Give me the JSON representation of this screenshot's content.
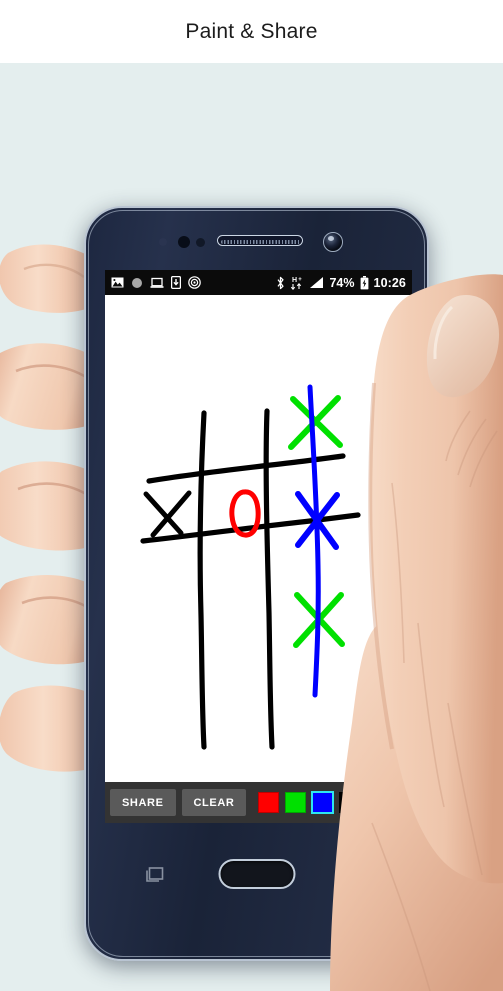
{
  "window": {
    "title": "Paint & Share",
    "background_color": "#e4eeee",
    "title_bar_color": "#ffffff"
  },
  "phone": {
    "device_style": "android-smartphone-in-hand",
    "hardware": {
      "speaker_name": "earpiece-speaker",
      "camera_name": "front-camera",
      "home_button_label": "Home",
      "recent_apps_label": "Recent apps",
      "back_label": "Back"
    }
  },
  "status_bar": {
    "background_color": "#0b0b0b",
    "text_color": "#ffffff",
    "left_icons": [
      {
        "name": "image-icon",
        "glyph": "⛰"
      },
      {
        "name": "circle-icon",
        "glyph": "●"
      },
      {
        "name": "laptop-icon",
        "glyph": "⌸"
      },
      {
        "name": "download-icon",
        "glyph": "⬇"
      },
      {
        "name": "cast-wireless-icon",
        "glyph": "὏6"
      }
    ],
    "right_icons": [
      {
        "name": "bluetooth-icon",
        "glyph": "ᛦ"
      },
      {
        "name": "hspa-plus-icon",
        "label": "H+"
      },
      {
        "name": "signal-icon",
        "glyph": "◢"
      }
    ],
    "battery_percent": "74%",
    "battery_icon_name": "battery-charging-icon",
    "clock": "10:26"
  },
  "app": {
    "canvas": {
      "name": "drawing-canvas",
      "background_color": "#ffffff",
      "content_description": "tic-tac-toe board sketch"
    },
    "toolbar": {
      "background_color": "#333333",
      "share_label": "SHARE",
      "clear_label": "CLEAR",
      "button_color": "#5a5a5a",
      "colors": [
        {
          "name": "swatch-red",
          "hex": "#ff0000",
          "selected": false
        },
        {
          "name": "swatch-green",
          "hex": "#00e000",
          "selected": false
        },
        {
          "name": "swatch-blue",
          "hex": "#0000ff",
          "selected": true
        },
        {
          "name": "swatch-black",
          "hex": "#000000",
          "selected": false
        },
        {
          "name": "swatch-white",
          "hex": "#ffffff",
          "selected": false
        }
      ],
      "selected_color_hex": "#0000ff",
      "selection_outline_hex": "#2ee6f0"
    }
  },
  "drawing": {
    "type": "freehand-sketch",
    "subject": "tic-tac-toe",
    "strokes": [
      {
        "id": "grid-vertical-left",
        "color": "#000000",
        "width": 5
      },
      {
        "id": "grid-vertical-right",
        "color": "#000000",
        "width": 5
      },
      {
        "id": "grid-horizontal-top",
        "color": "#000000",
        "width": 5
      },
      {
        "id": "grid-horizontal-bottom",
        "color": "#000000",
        "width": 5
      },
      {
        "id": "x-mark-middle-left",
        "color": "#000000",
        "width": 5
      },
      {
        "id": "o-mark-center",
        "color": "#ff0000",
        "width": 5
      },
      {
        "id": "x-mark-top-right",
        "color": "#00e000",
        "width": 6
      },
      {
        "id": "x-mark-middle-right",
        "color": "#0000ff",
        "width": 6
      },
      {
        "id": "x-mark-bottom-right",
        "color": "#00e000",
        "width": 6
      },
      {
        "id": "win-line-right-column",
        "color": "#0000ff",
        "width": 5
      }
    ]
  }
}
